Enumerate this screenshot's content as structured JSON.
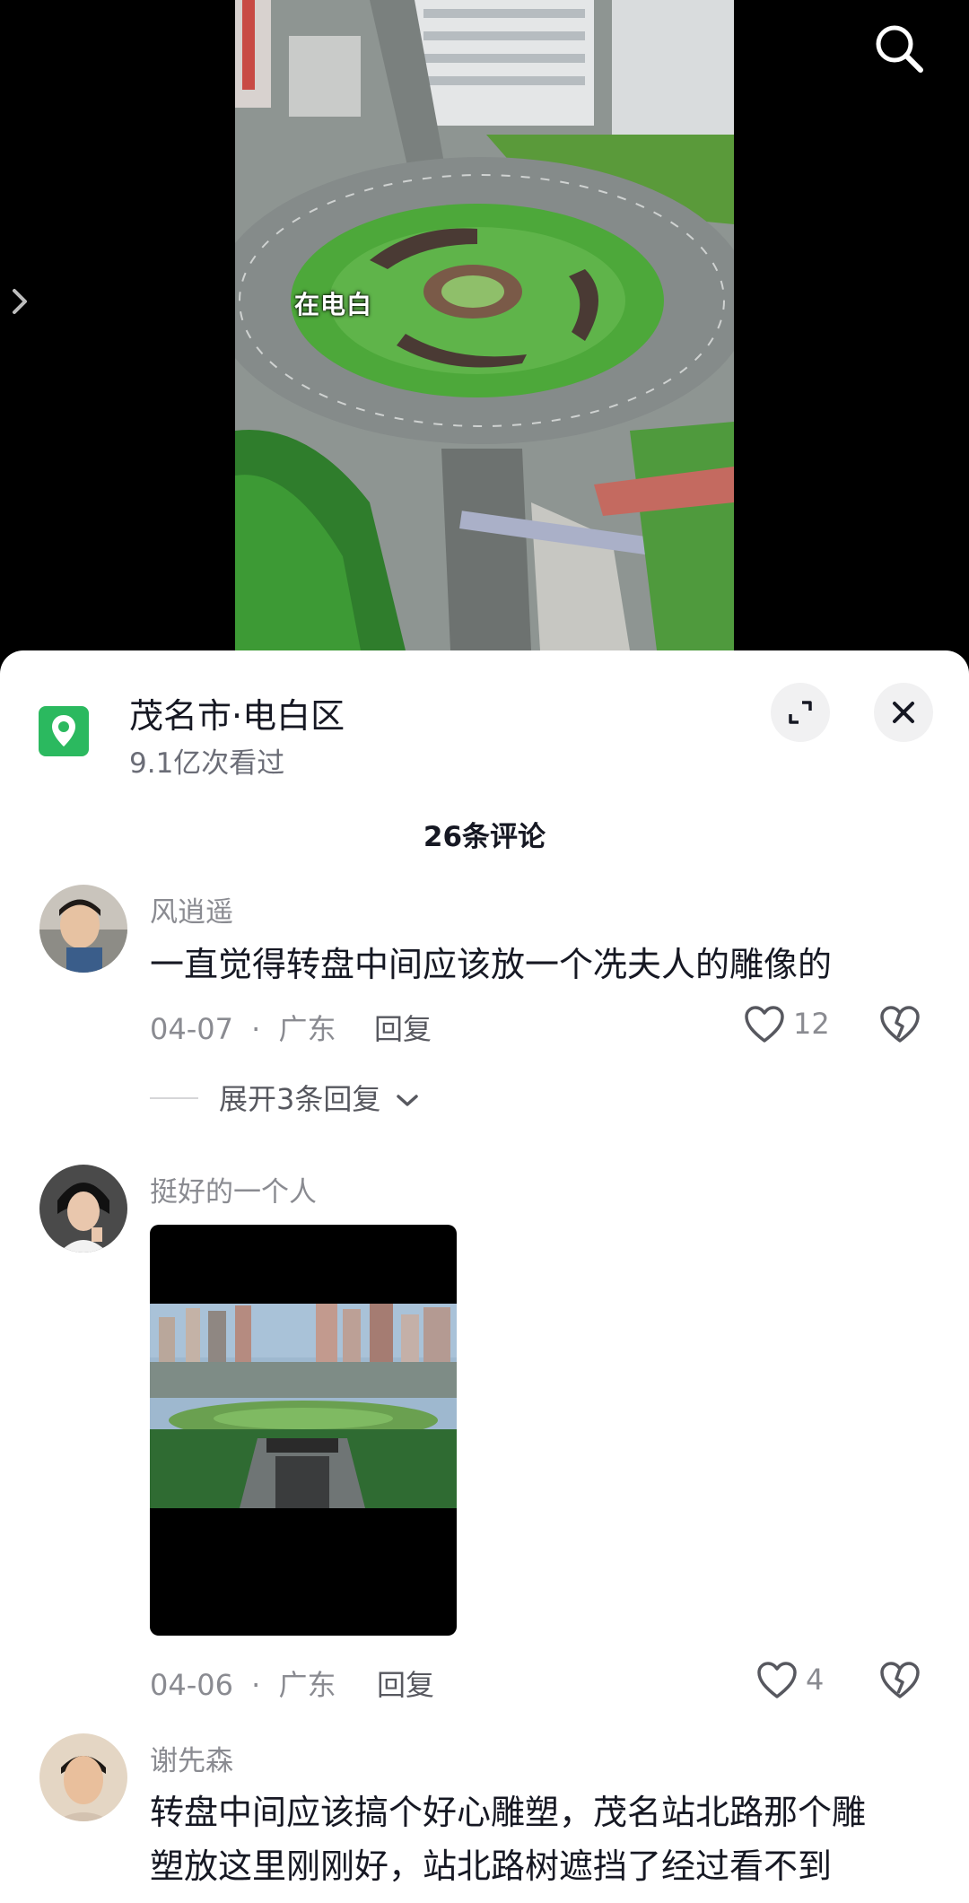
{
  "video": {
    "caption": "在电白"
  },
  "sheet": {
    "location_title": "茂名市·电白区",
    "views": "9.1亿次看过",
    "comment_count": "26条评论",
    "comments": [
      {
        "username": "风逍遥",
        "text": "一直觉得转盘中间应该放一个冼夫人的雕像的",
        "date": "04-07",
        "region": "广东",
        "reply_label": "回复",
        "likes": "12",
        "expand_replies": "展开3条回复"
      },
      {
        "username": "挺好的一个人",
        "date": "04-06",
        "region": "广东",
        "reply_label": "回复",
        "likes": "4"
      },
      {
        "username": "谢先森",
        "text_line1": "转盘中间应该搞个好心雕塑，茂名站北路那个雕",
        "text_line2": "塑放这里刚刚好，站北路树遮挡了经过看不到"
      }
    ],
    "separator": "·"
  },
  "colors": {
    "location_icon": "#2bb95f",
    "text_primary": "#161823",
    "text_secondary": "#8a8b91"
  }
}
